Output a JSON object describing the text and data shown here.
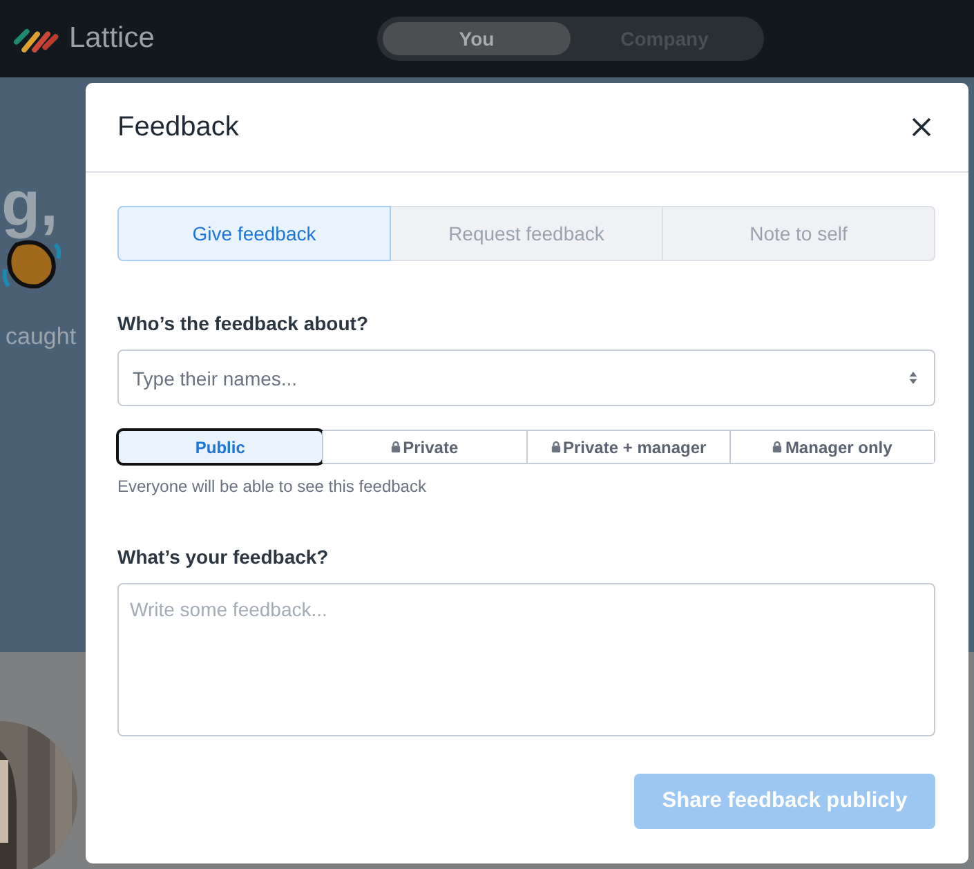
{
  "app": {
    "name": "Lattice"
  },
  "top_switch": [
    {
      "label": "You",
      "selected": true
    },
    {
      "label": "Company",
      "selected": false
    }
  ],
  "background": {
    "heading_fragment": "g,",
    "text_fragment": "caught"
  },
  "modal": {
    "title": "Feedback",
    "tabs": [
      {
        "label": "Give feedback",
        "selected": true
      },
      {
        "label": "Request feedback",
        "selected": false
      },
      {
        "label": "Note to self",
        "selected": false
      }
    ],
    "about_label": "Who’s the feedback about?",
    "about_field": {
      "placeholder": "Type their names..."
    },
    "visibility": [
      {
        "label": "Public",
        "selected": true,
        "locked": false
      },
      {
        "label": "Private",
        "selected": false,
        "locked": true
      },
      {
        "label": "Private + manager",
        "selected": false,
        "locked": true
      },
      {
        "label": "Manager only",
        "selected": false,
        "locked": true
      }
    ],
    "visibility_hint": "Everyone will be able to see this feedback",
    "feedback_label": "What’s your feedback?",
    "feedback_field": {
      "placeholder": "Write some feedback..."
    },
    "submit": {
      "label": "Share feedback publicly",
      "disabled": true
    }
  }
}
